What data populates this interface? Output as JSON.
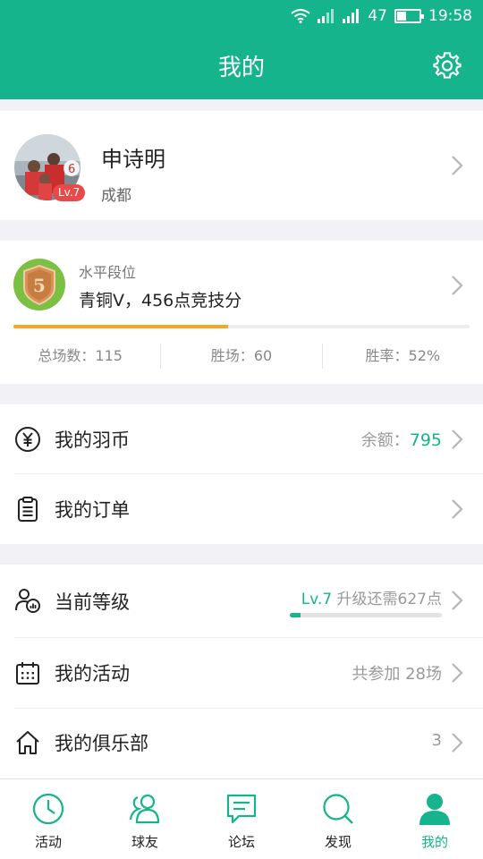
{
  "status_bar": {
    "signal_text": "47",
    "time": "19:58"
  },
  "header": {
    "title": "我的",
    "settings_icon": "gear-icon"
  },
  "profile": {
    "name": "申诗明",
    "city": "成都",
    "level_badge": "Lv.7"
  },
  "rank": {
    "label": "水平段位",
    "value": "青铜V，456点竞技分",
    "emblem_number": "5",
    "progress": 0.47,
    "stats": [
      {
        "label": "总场数：",
        "value": "115"
      },
      {
        "label": "胜场：",
        "value": "60"
      },
      {
        "label": "胜率：",
        "value": "52%"
      }
    ]
  },
  "wallet": {
    "coins": {
      "label": "我的羽币",
      "right_label": "余额：",
      "right_value": "795"
    },
    "orders": {
      "label": "我的订单"
    }
  },
  "activity": {
    "level": {
      "label": "当前等级",
      "level_text": "Lv.7",
      "upgrade_text": " 升级还需627点",
      "progress": 0.07
    },
    "events": {
      "label": "我的活动",
      "right": "共参加 28场"
    },
    "clubs": {
      "label": "我的俱乐部",
      "right": "3"
    }
  },
  "nav": [
    {
      "label": "活动",
      "icon": "clock-icon"
    },
    {
      "label": "球友",
      "icon": "friends-icon"
    },
    {
      "label": "论坛",
      "icon": "chat-icon"
    },
    {
      "label": "发现",
      "icon": "search-icon"
    },
    {
      "label": "我的",
      "icon": "person-icon",
      "active": true
    }
  ],
  "colors": {
    "primary": "#15b48c",
    "accent_orange": "#f5a623",
    "badge_red": "#e84a4a"
  }
}
